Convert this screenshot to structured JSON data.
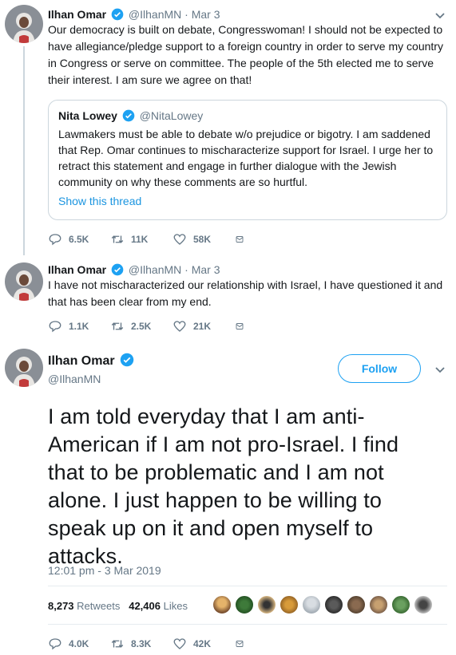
{
  "colors": {
    "accent": "#1da1f2",
    "link": "#1b95e0",
    "muted": "#657786",
    "border": "#ccd6dd"
  },
  "tweet1": {
    "author_name": "Ilhan Omar",
    "handle": "@IlhanMN",
    "dot": "·",
    "date": "Mar 3",
    "text": "Our democracy is built on debate, Congresswoman! I should not be expected to have allegiance/pledge support to a foreign country in order to serve my country in Congress or serve on committee. The people of the 5th elected me to serve their interest. I am sure we agree on that!",
    "quote": {
      "author_name": "Nita Lowey",
      "handle": "@NitaLowey",
      "text": "Lawmakers must be able to debate w/o prejudice or bigotry. I am saddened that Rep. Omar continues to mischaracterize support for Israel. I urge her to retract this statement and engage in further dialogue with the Jewish community on why these comments are so hurtful.",
      "link": "Show this thread"
    },
    "replies": "6.5K",
    "retweets": "11K",
    "likes": "58K"
  },
  "tweet2": {
    "author_name": "Ilhan Omar",
    "handle": "@IlhanMN",
    "dot": "·",
    "date": "Mar 3",
    "text": "I have not mischaracterized our relationship with Israel, I have questioned it and that has been clear from my end.",
    "replies": "1.1K",
    "retweets": "2.5K",
    "likes": "21K"
  },
  "tweet3": {
    "author_name": "Ilhan Omar",
    "handle": "@IlhanMN",
    "follow_label": "Follow",
    "text": "I am told everyday that I am anti-American if I am not pro-Israel. I find that to be problematic and I am not alone. I just happen to be willing to speak up on it and open myself to attacks.",
    "timestamp": "12:01 pm - 3 Mar 2019",
    "retweet_count": "8,273",
    "retweet_label": "Retweets",
    "like_count": "42,406",
    "like_label": "Likes",
    "replies": "4.0K",
    "retweets": "8.3K",
    "likes": "42K"
  },
  "icons": [
    "verified-badge-icon",
    "chevron-down-icon",
    "reply-icon",
    "retweet-icon",
    "like-icon",
    "direct-message-icon",
    "avatar"
  ]
}
